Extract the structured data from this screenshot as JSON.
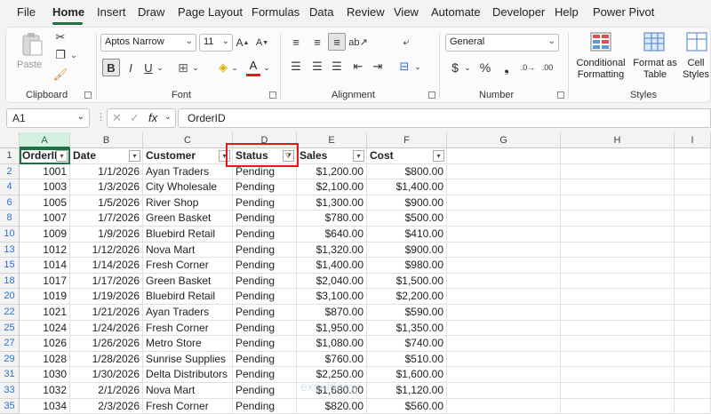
{
  "menu": {
    "items": [
      "File",
      "Home",
      "Insert",
      "Draw",
      "Page Layout",
      "Formulas",
      "Data",
      "Review",
      "View",
      "Automate",
      "Developer",
      "Help",
      "Power Pivot"
    ],
    "active": "Home"
  },
  "ribbon": {
    "clipboard": {
      "label": "Clipboard",
      "paste": "Paste"
    },
    "font": {
      "label": "Font",
      "name": "Aptos Narrow",
      "size": "11",
      "bold": "B",
      "italic": "I",
      "underline": "U"
    },
    "alignment": {
      "label": "Alignment"
    },
    "number": {
      "label": "Number",
      "format": "General",
      "currency": "$",
      "percent": "%"
    },
    "styles": {
      "label": "Styles",
      "conditional": "Conditional Formatting",
      "format_table": "Format as Table",
      "cell_styles": "Cell Styles"
    }
  },
  "formula_bar": {
    "name_box": "A1",
    "fx": "fx",
    "content": "OrderID"
  },
  "columns": [
    "A",
    "B",
    "C",
    "D",
    "E",
    "F",
    "G",
    "H",
    "I"
  ],
  "headers": [
    "OrderID",
    "Date",
    "Customer",
    "Status",
    "Sales",
    "Cost"
  ],
  "rows": [
    {
      "row": "2",
      "id": "1001",
      "date": "1/1/2026",
      "customer": "Ayan Traders",
      "status": "Pending",
      "sales": "$1,200.00",
      "cost": "$800.00"
    },
    {
      "row": "4",
      "id": "1003",
      "date": "1/3/2026",
      "customer": "City Wholesale",
      "status": "Pending",
      "sales": "$2,100.00",
      "cost": "$1,400.00"
    },
    {
      "row": "6",
      "id": "1005",
      "date": "1/5/2026",
      "customer": "River Shop",
      "status": "Pending",
      "sales": "$1,300.00",
      "cost": "$900.00"
    },
    {
      "row": "8",
      "id": "1007",
      "date": "1/7/2026",
      "customer": "Green Basket",
      "status": "Pending",
      "sales": "$780.00",
      "cost": "$500.00"
    },
    {
      "row": "10",
      "id": "1009",
      "date": "1/9/2026",
      "customer": "Bluebird Retail",
      "status": "Pending",
      "sales": "$640.00",
      "cost": "$410.00"
    },
    {
      "row": "13",
      "id": "1012",
      "date": "1/12/2026",
      "customer": "Nova Mart",
      "status": "Pending",
      "sales": "$1,320.00",
      "cost": "$900.00"
    },
    {
      "row": "15",
      "id": "1014",
      "date": "1/14/2026",
      "customer": "Fresh Corner",
      "status": "Pending",
      "sales": "$1,400.00",
      "cost": "$980.00"
    },
    {
      "row": "18",
      "id": "1017",
      "date": "1/17/2026",
      "customer": "Green Basket",
      "status": "Pending",
      "sales": "$2,040.00",
      "cost": "$1,500.00"
    },
    {
      "row": "20",
      "id": "1019",
      "date": "1/19/2026",
      "customer": "Bluebird Retail",
      "status": "Pending",
      "sales": "$3,100.00",
      "cost": "$2,200.00"
    },
    {
      "row": "22",
      "id": "1021",
      "date": "1/21/2026",
      "customer": "Ayan Traders",
      "status": "Pending",
      "sales": "$870.00",
      "cost": "$590.00"
    },
    {
      "row": "25",
      "id": "1024",
      "date": "1/24/2026",
      "customer": "Fresh Corner",
      "status": "Pending",
      "sales": "$1,950.00",
      "cost": "$1,350.00"
    },
    {
      "row": "27",
      "id": "1026",
      "date": "1/26/2026",
      "customer": "Metro Store",
      "status": "Pending",
      "sales": "$1,080.00",
      "cost": "$740.00"
    },
    {
      "row": "29",
      "id": "1028",
      "date": "1/28/2026",
      "customer": "Sunrise Supplies",
      "status": "Pending",
      "sales": "$760.00",
      "cost": "$510.00"
    },
    {
      "row": "31",
      "id": "1030",
      "date": "1/30/2026",
      "customer": "Delta Distributors",
      "status": "Pending",
      "sales": "$2,250.00",
      "cost": "$1,600.00"
    },
    {
      "row": "33",
      "id": "1032",
      "date": "2/1/2026",
      "customer": "Nova Mart",
      "status": "Pending",
      "sales": "$1,680.00",
      "cost": "$1,120.00"
    },
    {
      "row": "35",
      "id": "1034",
      "date": "2/3/2026",
      "customer": "Fresh Corner",
      "status": "Pending",
      "sales": "$820.00",
      "cost": "$560.00"
    }
  ],
  "watermark": "exceldemy"
}
